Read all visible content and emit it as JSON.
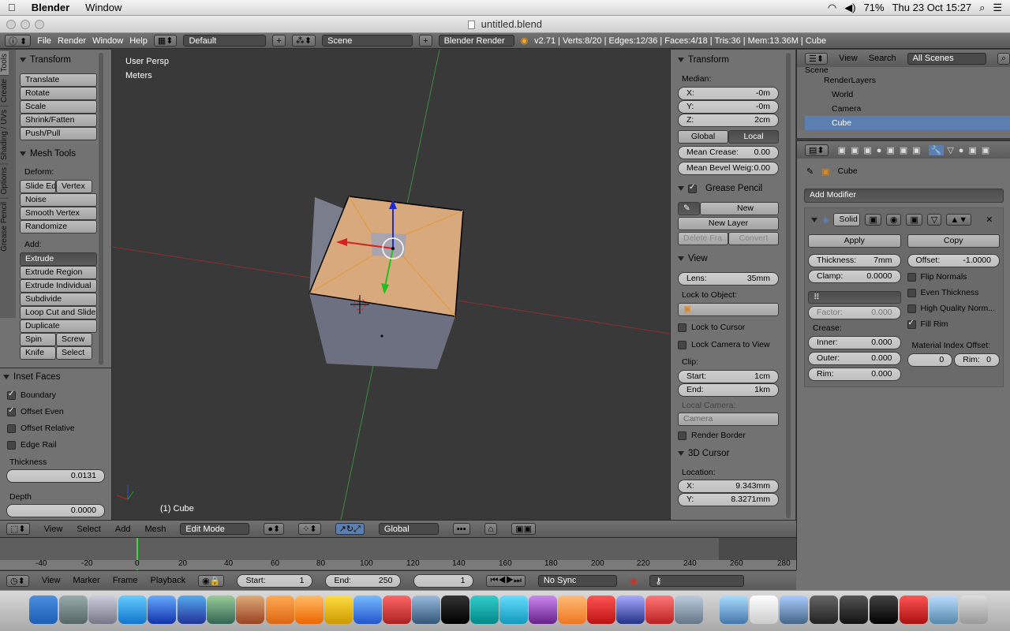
{
  "menubar": {
    "app": "Blender",
    "window": "Window",
    "clock": "Thu 23 Oct  15:27",
    "battery": "71%"
  },
  "title": "untitled.blend",
  "header": {
    "file": "File",
    "render": "Render",
    "window": "Window",
    "help": "Help",
    "layout": "Default",
    "scene": "Scene",
    "engine": "Blender Render",
    "stats": "v2.71 | Verts:8/20 | Edges:12/36 | Faces:4/18 | Tris:36 | Mem:13.36M | Cube"
  },
  "tools": {
    "vtabs": [
      "Tools",
      "Create",
      "Shading / UVs",
      "Options",
      "Grease Pencil"
    ],
    "transform_title": "Transform",
    "transform": [
      "Translate",
      "Rotate",
      "Scale",
      "Shrink/Fatten",
      "Push/Pull"
    ],
    "mesh_title": "Mesh Tools",
    "deform_label": "Deform:",
    "slide_edge": "Slide Ed",
    "vertex": "Vertex",
    "noise": "Noise",
    "smooth_vertex": "Smooth Vertex",
    "randomize": "Randomize",
    "add_label": "Add:",
    "extrude": "Extrude",
    "extrude_region": "Extrude Region",
    "extrude_individual": "Extrude Individual",
    "subdivide": "Subdivide",
    "loop_cut": "Loop Cut and Slide",
    "duplicate": "Duplicate",
    "spin": "Spin",
    "screw": "Screw",
    "knife": "Knife",
    "select": "Select"
  },
  "operator": {
    "title": "Inset Faces",
    "boundary": "Boundary",
    "offset_even": "Offset Even",
    "offset_relative": "Offset Relative",
    "edge_rail": "Edge Rail",
    "thickness_label": "Thickness",
    "thickness": "0.0131",
    "depth_label": "Depth",
    "depth": "0.0000"
  },
  "viewport": {
    "persp": "User Persp",
    "units": "Meters",
    "object": "(1) Cube"
  },
  "npanel": {
    "transform": "Transform",
    "median": "Median:",
    "x_l": "X:",
    "x": "-0m",
    "y_l": "Y:",
    "y": "-0m",
    "z_l": "Z:",
    "z": "2cm",
    "global": "Global",
    "local": "Local",
    "crease_l": "Mean Crease:",
    "crease": "0.00",
    "bevel_l": "Mean Bevel Weig:",
    "bevel": "0.00",
    "gp_title": "Grease Pencil",
    "new": "New",
    "new_layer": "New Layer",
    "delete_frame": "Delete Fra...",
    "convert": "Convert",
    "view_title": "View",
    "lens_l": "Lens:",
    "lens": "35mm",
    "lock_obj": "Lock to Object:",
    "lock_cursor": "Lock to Cursor",
    "lock_cam": "Lock Camera to View",
    "clip": "Clip:",
    "start_l": "Start:",
    "start": "1cm",
    "end_l": "End:",
    "end": "1km",
    "local_cam": "Local Camera:",
    "camera": "Camera",
    "render_border": "Render Border",
    "cursor_title": "3D Cursor",
    "location": "Location:",
    "cx_l": "X:",
    "cx": "9.343mm",
    "cy_l": "Y:",
    "cy": "8.3271mm"
  },
  "outliner": {
    "view": "View",
    "search": "Search",
    "scenes": "All Scenes",
    "items": [
      "Scene",
      "RenderLayers",
      "World",
      "Camera",
      "Cube"
    ]
  },
  "props": {
    "object": "Cube",
    "add_modifier": "Add Modifier",
    "mod_name": "Solid",
    "apply": "Apply",
    "copy": "Copy",
    "thickness_l": "Thickness:",
    "thickness": "7mm",
    "offset_l": "Offset:",
    "offset": "-1.0000",
    "clamp_l": "Clamp:",
    "clamp": "0.0000",
    "flip": "Flip Normals",
    "even": "Even Thickness",
    "hq": "High Quality Norm...",
    "fill_rim": "Fill Rim",
    "factor_l": "Factor:",
    "factor": "0.000",
    "crease": "Crease:",
    "inner_l": "Inner:",
    "inner": "0.000",
    "outer_l": "Outer:",
    "outer": "0.000",
    "rim_l": "Rim:",
    "rim": "0.000",
    "mat_idx": "Material Index Offset:",
    "mi0": "0",
    "mi_rim_l": "Rim:",
    "mi_rim": "0"
  },
  "view3dbar": {
    "view": "View",
    "select": "Select",
    "add": "Add",
    "mesh": "Mesh",
    "mode": "Edit Mode",
    "orient": "Global"
  },
  "timeline": {
    "ticks": [
      "-40",
      "-20",
      "0",
      "20",
      "40",
      "60",
      "80",
      "100",
      "120",
      "140",
      "160",
      "180",
      "200",
      "220",
      "240",
      "260",
      "280"
    ],
    "view": "View",
    "marker": "Marker",
    "frame": "Frame",
    "playback": "Playback",
    "start_l": "Start:",
    "start": "1",
    "end_l": "End:",
    "end": "250",
    "current": "1",
    "sync": "No Sync"
  }
}
